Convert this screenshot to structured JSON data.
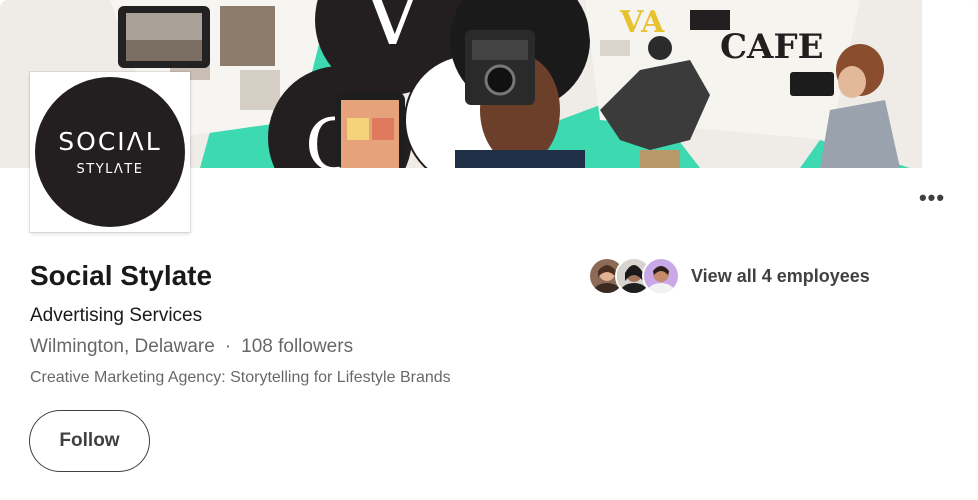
{
  "company": {
    "name": "Social Stylate",
    "industry": "Advertising Services",
    "location": "Wilmington, Delaware",
    "separator": "·",
    "followers": "108 followers",
    "tagline": "Creative Marketing Agency: Storytelling for Lifestyle Brands"
  },
  "logo": {
    "main_text": "SOCIΛL",
    "sub_text": "STYLΛTE",
    "bg_color": "#231f20"
  },
  "actions": {
    "follow_label": "Follow",
    "more_label": "•••"
  },
  "employees": {
    "label": "View all 4 employees",
    "avatar_count": 3
  },
  "cover": {
    "accent_color": "#3dd9b0",
    "letter_left": "V",
    "letter_mid": "C",
    "word_cafe": "CAFE",
    "word_va": "VA"
  }
}
